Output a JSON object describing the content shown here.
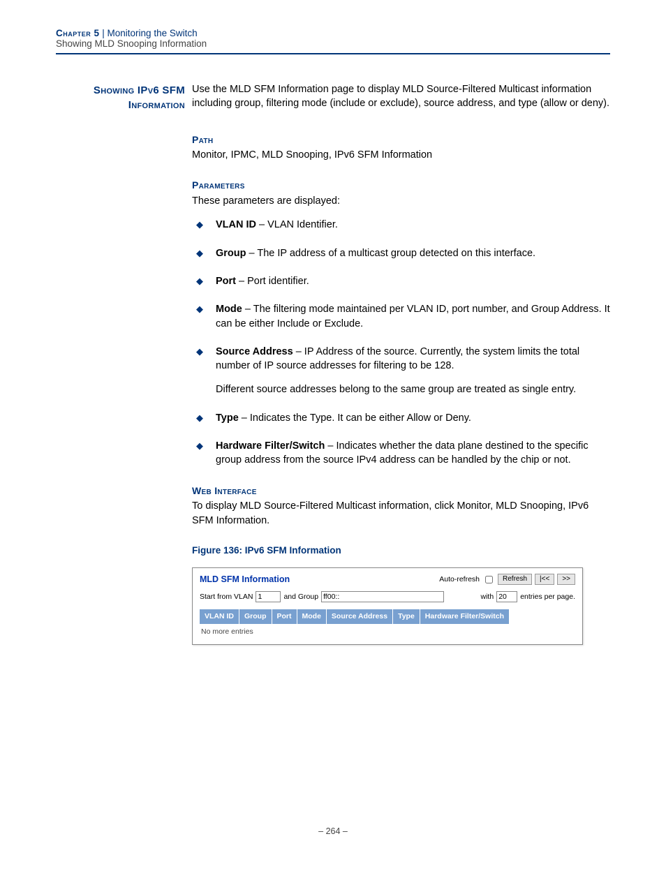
{
  "header": {
    "chapter": "Chapter 5",
    "sep": "  |  ",
    "title": "Monitoring the Switch",
    "subtitle": "Showing MLD Snooping Information"
  },
  "side_heading": {
    "line1": "Showing IPv6 SFM",
    "line2": "Information"
  },
  "intro": "Use the MLD SFM Information page to display MLD Source-Filtered Multicast information including group, filtering mode (include or exclude), source address, and type (allow or deny).",
  "path": {
    "label": "Path",
    "text": "Monitor, IPMC, MLD Snooping, IPv6 SFM Information"
  },
  "parameters": {
    "label": "Parameters",
    "intro": "These parameters are displayed:",
    "items": [
      {
        "term": "VLAN ID",
        "desc": " – VLAN Identifier."
      },
      {
        "term": "Group",
        "desc": " – The IP address of a multicast group detected on this interface."
      },
      {
        "term": "Port",
        "desc": " – Port identifier."
      },
      {
        "term": "Mode",
        "desc": " – The filtering mode maintained per VLAN ID, port number, and Group Address. It can be either Include or Exclude."
      },
      {
        "term": "Source Address",
        "desc": " – IP Address of the source. Currently, the system limits the total number of IP source addresses for filtering to be 128.",
        "extra": "Different source addresses belong to the same group are treated as single entry."
      },
      {
        "term": "Type",
        "desc": " – Indicates the Type. It can be either Allow or Deny."
      },
      {
        "term": "Hardware Filter/Switch",
        "desc": " – Indicates whether the data plane destined to the specific group address from the source IPv4 address can be handled by the chip or not."
      }
    ]
  },
  "web": {
    "label": "Web Interface",
    "text": "To display MLD Source-Filtered Multicast information, click Monitor, MLD Snooping, IPv6 SFM Information."
  },
  "figure": {
    "caption": "Figure 136:  IPv6 SFM Information"
  },
  "shot": {
    "title": "MLD SFM Information",
    "auto_refresh_label": "Auto-refresh",
    "refresh_btn": "Refresh",
    "first_btn": "|<<",
    "next_btn": ">>",
    "start_label": "Start from VLAN",
    "start_value": "1",
    "group_label": "and Group",
    "group_value": "ff00::",
    "with_label": "with",
    "with_value": "20",
    "entries_label": "entries per page.",
    "headers": [
      "VLAN ID",
      "Group",
      "Port",
      "Mode",
      "Source Address",
      "Type",
      "Hardware Filter/Switch"
    ],
    "nomore": "No more entries"
  },
  "page_number": "– 264 –"
}
